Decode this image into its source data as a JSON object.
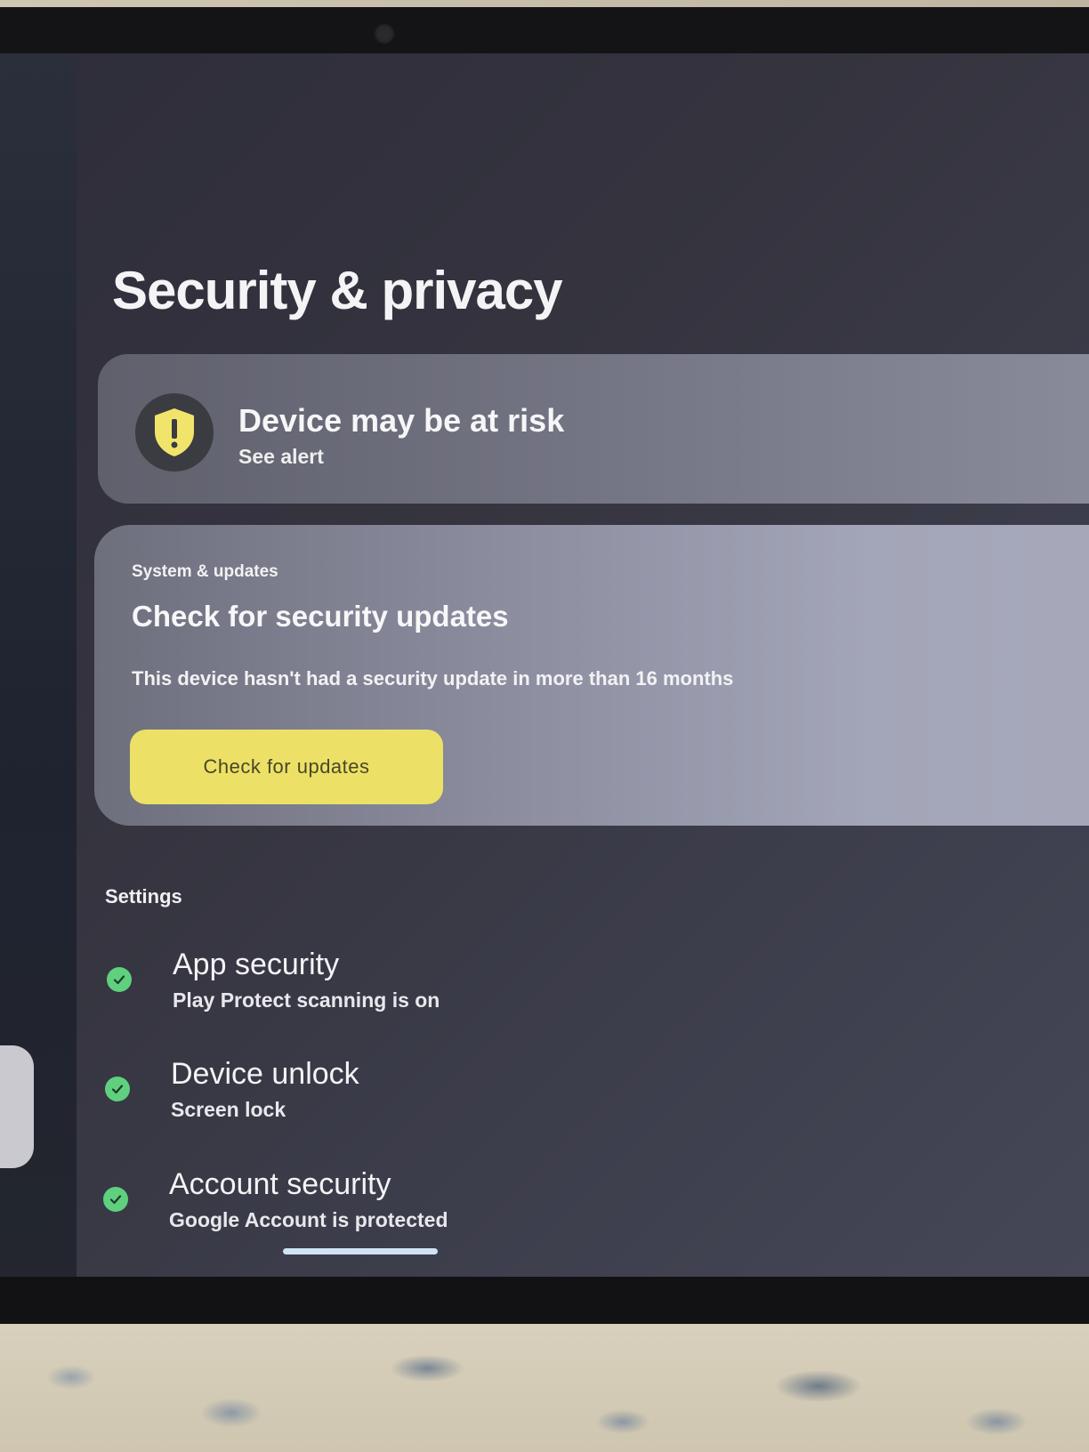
{
  "header": {
    "title": "Security & privacy"
  },
  "alert": {
    "title": "Device may be at risk",
    "subtitle": "See alert",
    "icon": "shield-alert-icon",
    "icon_color": "#f1e46a"
  },
  "updates": {
    "eyebrow": "System & updates",
    "title": "Check for security updates",
    "description": "This device hasn't had a security update in more than 16 months",
    "button_label": "Check for updates",
    "button_color": "#ece166"
  },
  "settings": {
    "section_label": "Settings",
    "items": [
      {
        "title": "App security",
        "subtitle": "Play Protect scanning is on",
        "status_icon": "check-circle-icon"
      },
      {
        "title": "Device unlock",
        "subtitle": "Screen lock",
        "status_icon": "check-circle-icon"
      },
      {
        "title": "Account security",
        "subtitle": "Google Account is protected",
        "status_icon": "check-circle-icon"
      }
    ],
    "status_color": "#5ed07e"
  }
}
